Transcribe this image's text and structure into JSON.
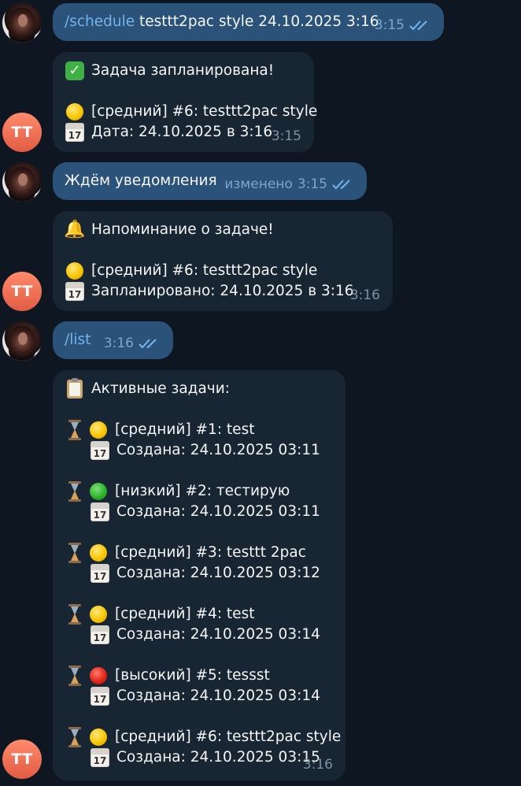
{
  "messages": [
    {
      "side": "out",
      "command": "/schedule",
      "text": " testtt2pac style 24.10.2025 3:16",
      "time": "3:15"
    },
    {
      "side": "in",
      "title": "Задача запланирована!",
      "task": "[средний] #6: testtt2pac style",
      "date_line": "Дата: 24.10.2025 в 3:16",
      "time": "3:15",
      "avatar": "TT"
    },
    {
      "side": "out",
      "text": "Ждём уведомления",
      "edited": "изменено",
      "time": "3:15"
    },
    {
      "side": "in",
      "title": "Напоминание о задаче!",
      "task": "[средний] #6: testtt2pac style",
      "date_line": "Запланировано: 24.10.2025 в 3:16",
      "time": "3:16",
      "avatar": "TT"
    },
    {
      "side": "out",
      "command": "/list",
      "time": "3:16"
    },
    {
      "side": "in",
      "title": "Активные задачи:",
      "time": "3:16",
      "avatar": "TT",
      "tasks": [
        {
          "priority": "yellow",
          "text": "[средний] #1: test",
          "created": "Создана: 24.10.2025 03:11"
        },
        {
          "priority": "green",
          "text": "[низкий] #2: тестирую",
          "created": "Создана: 24.10.2025 03:11"
        },
        {
          "priority": "yellow",
          "text": "[средний] #3: testtt 2pac",
          "created": "Создана: 24.10.2025 03:12"
        },
        {
          "priority": "yellow",
          "text": "[средний] #4: test",
          "created": "Создана: 24.10.2025 03:14"
        },
        {
          "priority": "red",
          "text": "[высокий] #5: tessst",
          "created": "Создана: 24.10.2025 03:14"
        },
        {
          "priority": "yellow",
          "text": "[средний] #6: testtt2pac style",
          "created": "Создана: 24.10.2025 03:15"
        }
      ]
    }
  ],
  "colors": {
    "background": "#0e1621",
    "outgoing": "#2b5278",
    "incoming": "#182533",
    "command": "#72b5ef"
  },
  "icons": [
    "check-mark-icon",
    "yellow-circle-icon",
    "green-circle-icon",
    "red-circle-icon",
    "calendar-icon",
    "bell-icon",
    "clipboard-icon",
    "hourglass-icon",
    "double-check-icon"
  ]
}
